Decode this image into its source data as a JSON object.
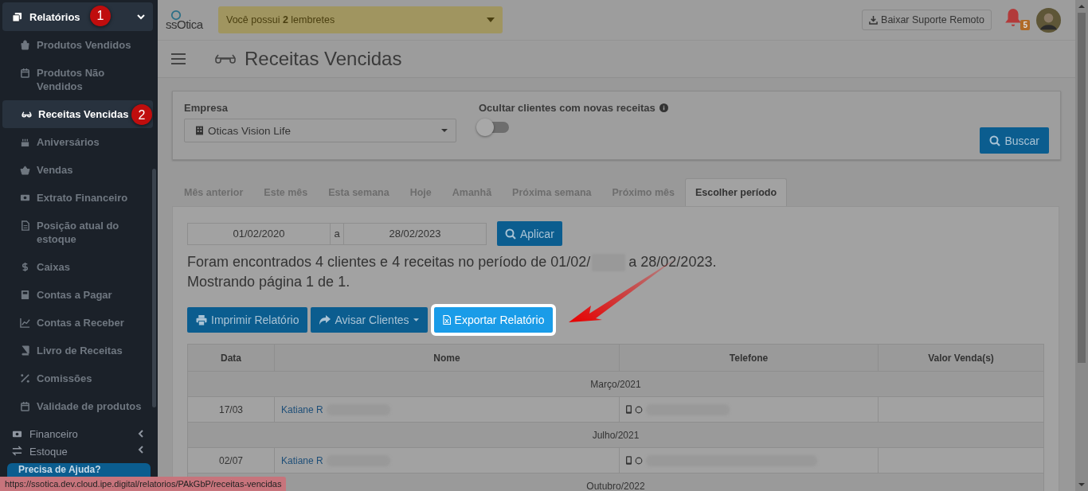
{
  "sidebar": {
    "items": [
      {
        "label": "Relatórios",
        "selected": true,
        "expanded": true,
        "badge": "1",
        "children": [
          {
            "label": "Produtos Vendidos",
            "selected": false
          },
          {
            "label": "Produtos Não Vendidos",
            "selected": false
          },
          {
            "label": "Receitas Vencidas",
            "selected": true,
            "badge": "2"
          },
          {
            "label": "Aniversários",
            "selected": false
          },
          {
            "label": "Vendas",
            "selected": false
          },
          {
            "label": "Extrato Financeiro",
            "selected": false
          },
          {
            "label": "Posição atual do estoque",
            "selected": false
          },
          {
            "label": "Caixas",
            "selected": false
          },
          {
            "label": "Contas a Pagar",
            "selected": false
          },
          {
            "label": "Contas a Receber",
            "selected": false
          },
          {
            "label": "Livro de Receitas",
            "selected": false
          },
          {
            "label": "Comissões",
            "selected": false
          },
          {
            "label": "Validade de produtos",
            "selected": false
          }
        ]
      },
      {
        "label": "Financeiro",
        "selected": false,
        "expanded": false
      },
      {
        "label": "Estoque",
        "selected": false,
        "expanded": false
      }
    ],
    "help_button": "Precisa de Ajuda?"
  },
  "topbar": {
    "logo_text": "ssOtica",
    "reminder_parts": [
      "Você possui ",
      "2",
      " lembretes"
    ],
    "support_button": "Baixar Suporte Remoto",
    "notification_count": "5"
  },
  "page": {
    "title": "Receitas Vencidas"
  },
  "filters": {
    "company_label": "Empresa",
    "company_value": "Oticas Vision Life",
    "hide_label": "Ocultar clientes com novas receitas",
    "hide_toggle": {
      "on": false
    },
    "search_button": "Buscar"
  },
  "tabs": [
    {
      "label": "Mês anterior",
      "selected": false
    },
    {
      "label": "Este mês",
      "selected": false
    },
    {
      "label": "Esta semana",
      "selected": false
    },
    {
      "label": "Hoje",
      "selected": false
    },
    {
      "label": "Amanhã",
      "selected": false
    },
    {
      "label": "Próxima semana",
      "selected": false
    },
    {
      "label": "Próximo mês",
      "selected": false
    },
    {
      "label": "Escolher período",
      "selected": true
    }
  ],
  "period": {
    "from": "01/02/2020",
    "separator": "a",
    "to": "28/02/2023",
    "apply_button": "Aplicar"
  },
  "summary": {
    "before": "Foram encontrados 4 clientes e 4 receitas no período de 01/02/",
    "after": "a 28/02/2023.",
    "paging": "Mostrando página 1 de 1."
  },
  "actions": [
    {
      "label": "Imprimir Relatório",
      "highlighted": false,
      "dropdown": false
    },
    {
      "label": "Avisar Clientes",
      "highlighted": false,
      "dropdown": true
    },
    {
      "label": "Exportar Relatório",
      "highlighted": true,
      "dropdown": false
    }
  ],
  "table": {
    "columns": [
      "Data",
      "Nome",
      "Telefone",
      "Valor Venda(s)"
    ],
    "rows": [
      {
        "kind": "group",
        "label": "Março/2021"
      },
      {
        "kind": "data",
        "date": "17/03",
        "name": "Katiane R"
      },
      {
        "kind": "group",
        "label": "Julho/2021"
      },
      {
        "kind": "data",
        "date": "02/07",
        "name": "Katiane R"
      },
      {
        "kind": "group",
        "label": "Outubro/2022"
      }
    ]
  },
  "status_url": "https://ssotica.dev.cloud.ipe.digital/relatorios/PAkGbP/receitas-vencidas"
}
